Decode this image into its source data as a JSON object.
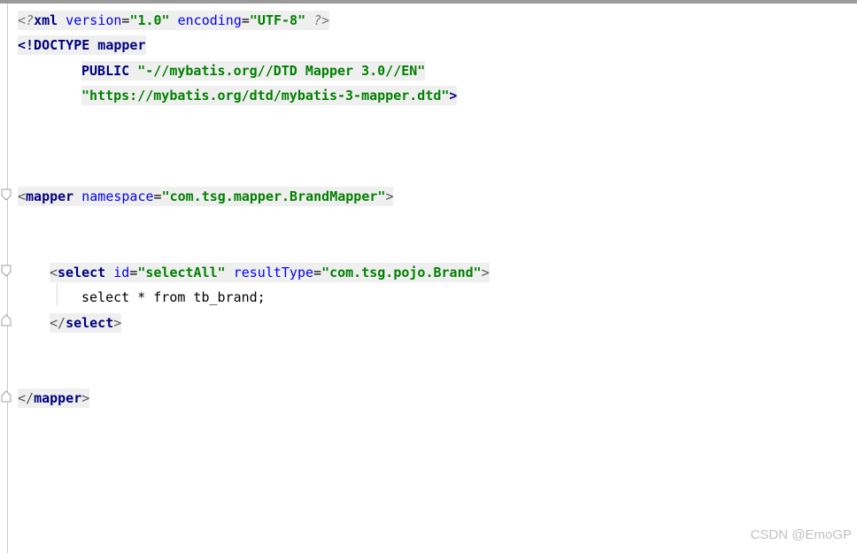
{
  "editor": {
    "lines": {
      "xml_decl": {
        "open": "<?",
        "name": "xml",
        "attr1": " version",
        "eq": "=",
        "val1": "\"1.0\"",
        "attr2": " encoding",
        "val2": "\"UTF-8\"",
        "close": " ?>"
      },
      "doctype": {
        "open": "<!DOCTYPE",
        "name": " mapper"
      },
      "public_line": {
        "kw": "PUBLIC",
        "val": " \"-//mybatis.org//DTD Mapper 3.0//EN\""
      },
      "dtd_line": {
        "val": "\"https://mybatis.org/dtd/mybatis-3-mapper.dtd\"",
        "close": ">"
      },
      "mapper_open": {
        "lt": "<",
        "tag": "mapper",
        "attr": " namespace",
        "eq": "=",
        "val": "\"com.tsg.mapper.BrandMapper\"",
        "gt": ">"
      },
      "select_open": {
        "lt": "<",
        "tag": "select",
        "attr1": " id",
        "eq": "=",
        "val1": "\"selectAll\"",
        "attr2": " resultType",
        "val2": "\"com.tsg.pojo.Brand\"",
        "gt": ">"
      },
      "sql_body": "select * from tb_brand;",
      "select_close": {
        "lt": "</",
        "tag": "select",
        "gt": ">"
      },
      "mapper_close": {
        "lt": "</",
        "tag": "mapper",
        "gt": ">"
      }
    }
  },
  "watermark": "CSDN @EmoGP",
  "icons": {
    "fold_open": "fold-open-icon",
    "fold_end": "fold-end-icon"
  },
  "colors": {
    "tag": "#000080",
    "attribute": "#0000ff",
    "string": "#008000",
    "line_highlight": "#efefef"
  }
}
